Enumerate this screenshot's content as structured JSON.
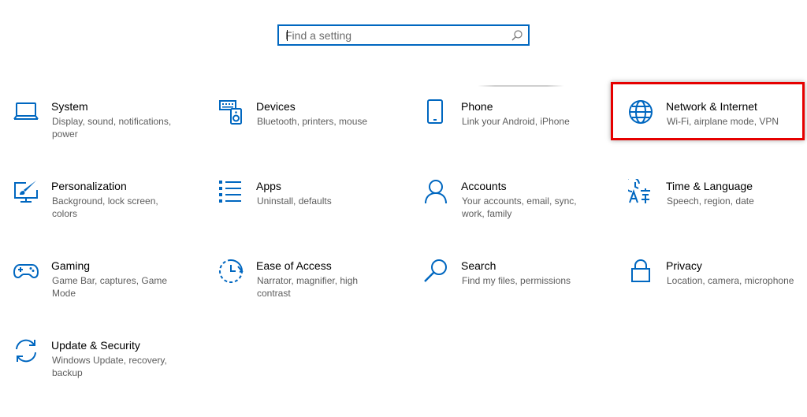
{
  "search": {
    "placeholder": "Find a setting",
    "icon": "search-icon"
  },
  "accent_color": "#0067c0",
  "highlight_color": "#e60000",
  "tiles": [
    {
      "title": "System",
      "desc": "Display, sound, notifications, power",
      "icon": "laptop-icon"
    },
    {
      "title": "Devices",
      "desc": "Bluetooth, printers, mouse",
      "icon": "keyboard-speaker-icon"
    },
    {
      "title": "Phone",
      "desc": "Link your Android, iPhone",
      "icon": "phone-icon"
    },
    {
      "title": "Network & Internet",
      "desc": "Wi-Fi, airplane mode, VPN",
      "icon": "globe-icon"
    },
    {
      "title": "Personalization",
      "desc": "Background, lock screen, colors",
      "icon": "paint-monitor-icon"
    },
    {
      "title": "Apps",
      "desc": "Uninstall, defaults",
      "icon": "apps-list-icon"
    },
    {
      "title": "Accounts",
      "desc": "Your accounts, email, sync, work, family",
      "icon": "person-icon"
    },
    {
      "title": "Time & Language",
      "desc": "Speech, region, date",
      "icon": "language-icon"
    },
    {
      "title": "Gaming",
      "desc": "Game Bar, captures, Game Mode",
      "icon": "gamepad-icon"
    },
    {
      "title": "Ease of Access",
      "desc": "Narrator, magnifier, high contrast",
      "icon": "ease-of-access-icon"
    },
    {
      "title": "Search",
      "desc": "Find my files, permissions",
      "icon": "magnifier-icon"
    },
    {
      "title": "Privacy",
      "desc": "Location, camera, microphone",
      "icon": "lock-icon"
    },
    {
      "title": "Update & Security",
      "desc": "Windows Update, recovery, backup",
      "icon": "sync-icon"
    }
  ]
}
